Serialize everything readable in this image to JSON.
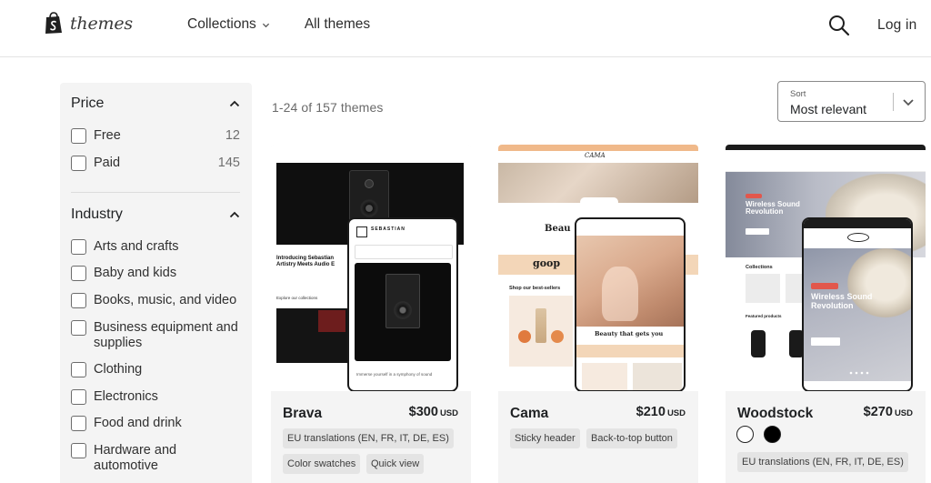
{
  "header": {
    "logo_text": "themes",
    "nav": [
      {
        "label": "Collections",
        "has_dropdown": true
      },
      {
        "label": "All themes",
        "has_dropdown": false
      }
    ],
    "search_icon": "search-icon",
    "login_label": "Log in"
  },
  "sidebar": {
    "price": {
      "title": "Price",
      "options": [
        {
          "label": "Free",
          "count": "12"
        },
        {
          "label": "Paid",
          "count": "145"
        }
      ]
    },
    "industry": {
      "title": "Industry",
      "options": [
        {
          "label": "Arts and crafts"
        },
        {
          "label": "Baby and kids"
        },
        {
          "label": "Books, music, and video"
        },
        {
          "label": "Business equipment and supplies"
        },
        {
          "label": "Clothing"
        },
        {
          "label": "Electronics"
        },
        {
          "label": "Food and drink"
        },
        {
          "label": "Hardware and automotive"
        }
      ]
    }
  },
  "results": {
    "count_text": "1-24 of 157 themes",
    "sort_label": "Sort",
    "sort_value": "Most relevant"
  },
  "cards": [
    {
      "name": "Brava",
      "price": "$300",
      "currency": "USD",
      "tags": [
        "EU translations (EN, FR, IT, DE, ES)",
        "Color swatches",
        "Quick view"
      ],
      "preview_text": {
        "headline": "Introducing Sebastian Artistry Meets Audio E",
        "section": "Explore our collections",
        "brand": "SEBASTIAN",
        "caption": "Immerse yourself in a symphony of sound"
      }
    },
    {
      "name": "Cama",
      "price": "$210",
      "currency": "USD",
      "tags": [
        "Sticky header",
        "Back-to-top button"
      ],
      "preview_text": {
        "logo": "CAMA",
        "headline": "Beau",
        "press": "goop",
        "section": "Shop our best-sellers",
        "phone_title": "Beauty that gets you"
      }
    },
    {
      "name": "Woodstock",
      "price": "$270",
      "currency": "USD",
      "swatches": [
        "#ffffff",
        "#000000"
      ],
      "tags": [
        "EU translations (EN, FR, IT, DE, ES)"
      ],
      "preview_text": {
        "headline": "Wireless Sound Revolution",
        "collections": "Collections",
        "featured": "Featured products",
        "phone_headline": "Wireless Sound Revolution"
      }
    }
  ]
}
